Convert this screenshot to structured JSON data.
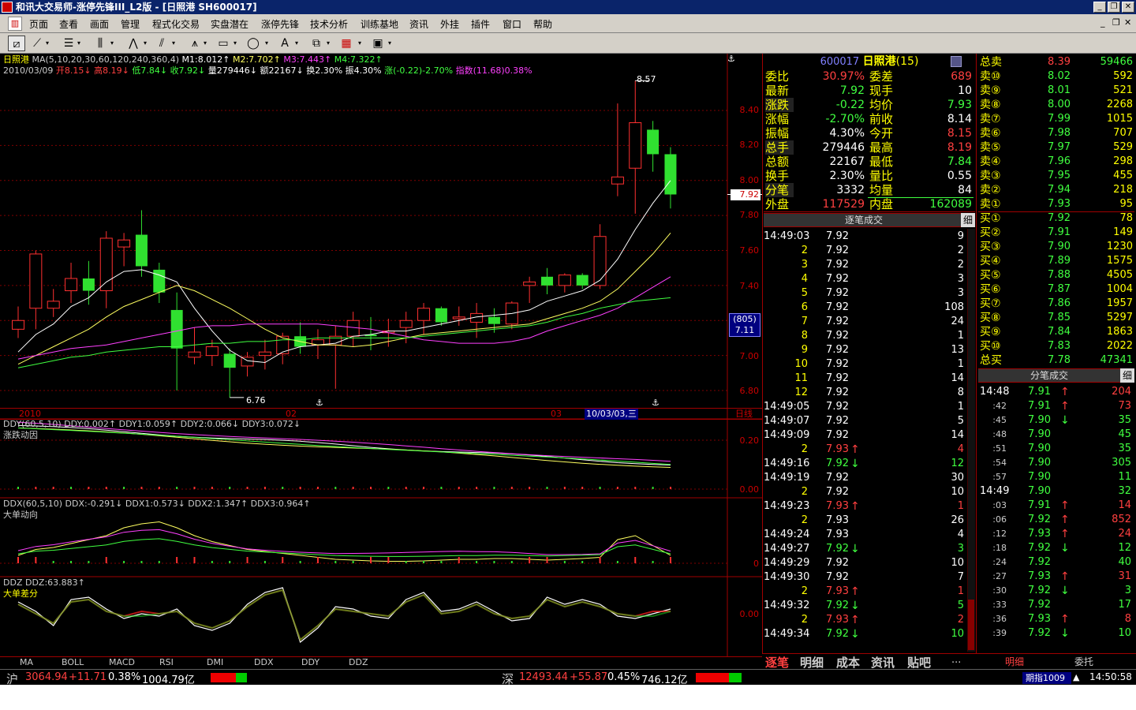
{
  "window": {
    "title": "和讯大交易师-涨停先锋III_L2版 - [日照港 SH600017]"
  },
  "menu": [
    "页面",
    "查看",
    "画面",
    "管理",
    "程式化交易",
    "实盘潜在",
    "涨停先锋",
    "技术分析",
    "训练基地",
    "资讯",
    "外挂",
    "插件",
    "窗口",
    "帮助"
  ],
  "chart": {
    "legend": {
      "stock": "日照港",
      "ma_label": "MA(5,10,20,30,60,120,240,360,4)",
      "m1": "M1:8.012↑",
      "m2": "M2:7.702↑",
      "m3": "M3:7.443↑",
      "m4": "M4:7.322↑"
    },
    "dayinfo": {
      "date": "2010/03/09",
      "open": "开8.15↓",
      "high": "高8.19↓",
      "low": "低7.84↓",
      "close": "收7.92↓",
      "vol": "量279446↓",
      "amt": "额22167↓",
      "turnover": "换2.30%",
      "amp": "振4.30%",
      "chg": "涨(-0.22)-2.70%",
      "index": "指数(11.68)0.38%"
    },
    "high_label": "8.57",
    "low_label": "6.76",
    "current_price": "7.92",
    "cursor_box": "(805)",
    "cursor_price": "7.11",
    "x_labels": {
      "y2010": "2010",
      "m02": "02",
      "m03": "03",
      "sel_date": "10/03/03,三"
    },
    "period": "日线"
  },
  "chart_data": {
    "type": "candlestick",
    "ylim": [
      6.72,
      8.64
    ],
    "yticks": [
      6.8,
      7.0,
      7.2,
      7.4,
      7.6,
      7.8,
      8.0,
      8.2,
      8.4
    ],
    "candles": [
      {
        "o": 7.15,
        "h": 7.28,
        "l": 7.1,
        "c": 7.2
      },
      {
        "o": 7.27,
        "h": 7.6,
        "l": 7.15,
        "c": 7.58
      },
      {
        "o": 7.27,
        "h": 7.38,
        "l": 7.22,
        "c": 7.31
      },
      {
        "o": 7.37,
        "h": 7.53,
        "l": 7.3,
        "c": 7.44
      },
      {
        "o": 7.44,
        "h": 7.54,
        "l": 7.29,
        "c": 7.37
      },
      {
        "o": 7.37,
        "h": 7.71,
        "l": 7.27,
        "c": 7.67
      },
      {
        "o": 7.62,
        "h": 7.7,
        "l": 7.51,
        "c": 7.66
      },
      {
        "o": 7.69,
        "h": 7.83,
        "l": 7.45,
        "c": 7.51
      },
      {
        "o": 7.49,
        "h": 7.53,
        "l": 7.3,
        "c": 7.36
      },
      {
        "o": 7.26,
        "h": 7.36,
        "l": 6.8,
        "c": 7.04
      },
      {
        "o": 6.99,
        "h": 7.16,
        "l": 6.95,
        "c": 7.02
      },
      {
        "o": 7.0,
        "h": 7.09,
        "l": 6.94,
        "c": 7.05
      },
      {
        "o": 7.01,
        "h": 7.04,
        "l": 6.76,
        "c": 6.93
      },
      {
        "o": 6.94,
        "h": 7.02,
        "l": 6.88,
        "c": 6.99
      },
      {
        "o": 7.0,
        "h": 7.09,
        "l": 6.92,
        "c": 7.02
      },
      {
        "o": 7.01,
        "h": 7.13,
        "l": 6.95,
        "c": 7.11
      },
      {
        "o": 7.11,
        "h": 7.19,
        "l": 7.01,
        "c": 7.05
      },
      {
        "o": 7.06,
        "h": 7.15,
        "l": 6.98,
        "c": 7.09
      },
      {
        "o": 7.06,
        "h": 7.17,
        "l": 6.81,
        "c": 7.11
      },
      {
        "o": 7.11,
        "h": 7.25,
        "l": 7.05,
        "c": 7.2
      },
      {
        "o": 7.12,
        "h": 7.22,
        "l": 7.03,
        "c": 7.11
      },
      {
        "o": 7.13,
        "h": 7.21,
        "l": 7.05,
        "c": 7.14
      },
      {
        "o": 7.16,
        "h": 7.25,
        "l": 7.07,
        "c": 7.2
      },
      {
        "o": 7.2,
        "h": 7.3,
        "l": 7.12,
        "c": 7.27
      },
      {
        "o": 7.27,
        "h": 7.28,
        "l": 7.17,
        "c": 7.19
      },
      {
        "o": 7.21,
        "h": 7.28,
        "l": 7.17,
        "c": 7.22
      },
      {
        "o": 7.19,
        "h": 7.3,
        "l": 7.1,
        "c": 7.24
      },
      {
        "o": 7.22,
        "h": 7.27,
        "l": 7.13,
        "c": 7.18
      },
      {
        "o": 7.18,
        "h": 7.31,
        "l": 7.15,
        "c": 7.3
      },
      {
        "o": 7.4,
        "h": 7.45,
        "l": 7.3,
        "c": 7.42
      },
      {
        "o": 7.45,
        "h": 7.5,
        "l": 7.35,
        "c": 7.4
      },
      {
        "o": 7.4,
        "h": 7.47,
        "l": 7.36,
        "c": 7.46
      },
      {
        "o": 7.46,
        "h": 7.47,
        "l": 7.38,
        "c": 7.4
      },
      {
        "o": 7.4,
        "h": 7.75,
        "l": 7.38,
        "c": 7.68
      },
      {
        "o": 7.98,
        "h": 8.44,
        "l": 7.91,
        "c": 8.02
      },
      {
        "o": 8.07,
        "h": 8.57,
        "l": 7.81,
        "c": 8.33
      },
      {
        "o": 8.29,
        "h": 8.34,
        "l": 8.05,
        "c": 8.15
      },
      {
        "o": 8.15,
        "h": 8.19,
        "l": 7.84,
        "c": 7.92
      }
    ],
    "ma": [
      {
        "color": "#ffffff",
        "values": [
          7.02,
          7.12,
          7.18,
          7.28,
          7.33,
          7.42,
          7.48,
          7.49,
          7.46,
          7.42,
          7.27,
          7.14,
          7.03,
          6.97,
          6.96,
          7.02,
          7.05,
          7.06,
          7.07,
          7.11,
          7.12,
          7.14,
          7.14,
          7.16,
          7.18,
          7.2,
          7.22,
          7.23,
          7.24,
          7.26,
          7.31,
          7.34,
          7.37,
          7.43,
          7.55,
          7.72,
          7.87,
          8.0
        ]
      },
      {
        "color": "#ffff60",
        "values": [
          6.95,
          7.0,
          7.05,
          7.1,
          7.15,
          7.22,
          7.28,
          7.32,
          7.36,
          7.4,
          7.37,
          7.32,
          7.27,
          7.21,
          7.15,
          7.1,
          7.08,
          7.06,
          7.06,
          7.05,
          7.06,
          7.08,
          7.1,
          7.12,
          7.13,
          7.14,
          7.15,
          7.16,
          7.17,
          7.18,
          7.21,
          7.24,
          7.27,
          7.31,
          7.38,
          7.48,
          7.58,
          7.7
        ]
      },
      {
        "color": "#ff40ff",
        "values": [
          6.98,
          7.0,
          7.02,
          7.04,
          7.05,
          7.06,
          7.08,
          7.1,
          7.12,
          7.14,
          7.16,
          7.17,
          7.17,
          7.18,
          7.18,
          7.18,
          7.18,
          7.18,
          7.17,
          7.16,
          7.15,
          7.13,
          7.11,
          7.09,
          7.08,
          7.07,
          7.07,
          7.07,
          7.08,
          7.1,
          7.14,
          7.17,
          7.2,
          7.23,
          7.27,
          7.33,
          7.39,
          7.45
        ]
      },
      {
        "color": "#40ff40",
        "values": [
          6.93,
          6.95,
          6.97,
          6.99,
          7.0,
          7.02,
          7.03,
          7.04,
          7.05,
          7.05,
          7.06,
          7.07,
          7.07,
          7.08,
          7.08,
          7.09,
          7.09,
          7.1,
          7.1,
          7.1,
          7.1,
          7.1,
          7.1,
          7.11,
          7.12,
          7.13,
          7.14,
          7.15,
          7.16,
          7.17,
          7.19,
          7.22,
          7.24,
          7.27,
          7.29,
          7.31,
          7.32,
          7.33
        ]
      }
    ]
  },
  "ind1": {
    "legend": "DDY(60,5,10) DDY:0.002↑ DDY1:0.059↑ DDY2:0.066↓ DDY3:0.072↓",
    "name": "涨跌动因",
    "ticks": [
      "0.20",
      "0.00"
    ]
  },
  "ind2": {
    "legend": "DDX(60,5,10) DDX:-0.291↓ DDX1:0.573↓ DDX2:1.347↑ DDX3:0.964↑",
    "name": "大单动向",
    "ticks": [
      "0"
    ]
  },
  "ind3": {
    "legend": "DDZ DDZ:63.883↑",
    "name": "大单差分",
    "ticks": [
      "0.00"
    ]
  },
  "tabs": [
    "MA",
    "BOLL",
    "MACD",
    "RSI",
    "DMI",
    "DDX",
    "DDY",
    "DDZ"
  ],
  "quote": {
    "code": "600017",
    "name": "日照港",
    "count": "(15)",
    "rows": [
      {
        "l1": "委比",
        "v1": "30.97%",
        "l2": "委差",
        "v2": "689"
      },
      {
        "l1": "最新",
        "v1": "7.92",
        "l2": "现手",
        "v2": "10"
      },
      {
        "l1": "涨跌",
        "v1": "-0.22",
        "l2": "均价",
        "v2": "7.93"
      },
      {
        "l1": "涨幅",
        "v1": "-2.70%",
        "l2": "前收",
        "v2": "8.14"
      },
      {
        "l1": "振幅",
        "v1": "4.30%",
        "l2": "今开",
        "v2": "8.15"
      },
      {
        "l1": "总手",
        "v1": "279446",
        "l2": "最高",
        "v2": "8.19"
      },
      {
        "l1": "总额",
        "v1": "22167",
        "l2": "最低",
        "v2": "7.84"
      },
      {
        "l1": "换手",
        "v1": "2.30%",
        "l2": "量比",
        "v2": "0.55"
      },
      {
        "l1": "分笔",
        "v1": "3332",
        "l2": "均量",
        "v2": "84"
      },
      {
        "l1": "外盘",
        "v1": "117529",
        "l2": "内盘",
        "v2": "162089"
      }
    ]
  },
  "ticks_title": "逐笔成交",
  "detail_btn": "细",
  "ticks": [
    {
      "t": "14:49:03",
      "p": "7.92",
      "v": "9",
      "c": "w"
    },
    {
      "t": "2",
      "p": "7.92",
      "v": "2",
      "c": "w"
    },
    {
      "t": "3",
      "p": "7.92",
      "v": "2",
      "c": "w"
    },
    {
      "t": "4",
      "p": "7.92",
      "v": "3",
      "c": "w"
    },
    {
      "t": "5",
      "p": "7.92",
      "v": "3",
      "c": "w"
    },
    {
      "t": "6",
      "p": "7.92",
      "v": "108",
      "c": "w"
    },
    {
      "t": "7",
      "p": "7.92",
      "v": "24",
      "c": "w"
    },
    {
      "t": "8",
      "p": "7.92",
      "v": "1",
      "c": "w"
    },
    {
      "t": "9",
      "p": "7.92",
      "v": "13",
      "c": "w"
    },
    {
      "t": "10",
      "p": "7.92",
      "v": "1",
      "c": "w"
    },
    {
      "t": "11",
      "p": "7.92",
      "v": "14",
      "c": "w"
    },
    {
      "t": "12",
      "p": "7.92",
      "v": "8",
      "c": "w"
    },
    {
      "t": "14:49:05",
      "p": "7.92",
      "v": "1",
      "c": "w"
    },
    {
      "t": "14:49:07",
      "p": "7.92",
      "v": "5",
      "c": "w"
    },
    {
      "t": "14:49:09",
      "p": "7.92",
      "v": "14",
      "c": "w"
    },
    {
      "t": "2",
      "p": "7.93",
      "v": "4",
      "c": "r"
    },
    {
      "t": "14:49:16",
      "p": "7.92",
      "v": "12",
      "c": "g"
    },
    {
      "t": "14:49:19",
      "p": "7.92",
      "v": "30",
      "c": "w"
    },
    {
      "t": "2",
      "p": "7.92",
      "v": "10",
      "c": "w"
    },
    {
      "t": "14:49:23",
      "p": "7.93",
      "v": "1",
      "c": "r"
    },
    {
      "t": "2",
      "p": "7.93",
      "v": "26",
      "c": "w"
    },
    {
      "t": "14:49:24",
      "p": "7.93",
      "v": "4",
      "c": "w"
    },
    {
      "t": "14:49:27",
      "p": "7.92",
      "v": "3",
      "c": "g"
    },
    {
      "t": "14:49:29",
      "p": "7.92",
      "v": "10",
      "c": "w"
    },
    {
      "t": "14:49:30",
      "p": "7.92",
      "v": "7",
      "c": "w"
    },
    {
      "t": "2",
      "p": "7.93",
      "v": "1",
      "c": "r"
    },
    {
      "t": "14:49:32",
      "p": "7.92",
      "v": "5",
      "c": "g"
    },
    {
      "t": "2",
      "p": "7.93",
      "v": "2",
      "c": "r"
    },
    {
      "t": "14:49:34",
      "p": "7.92",
      "v": "10",
      "c": "g"
    }
  ],
  "orderbook": {
    "total_sell": {
      "l": "总卖",
      "p": "8.39",
      "v": "59466"
    },
    "sells": [
      {
        "l": "卖⑩",
        "p": "8.02",
        "v": "592"
      },
      {
        "l": "卖⑨",
        "p": "8.01",
        "v": "521"
      },
      {
        "l": "卖⑧",
        "p": "8.00",
        "v": "2268"
      },
      {
        "l": "卖⑦",
        "p": "7.99",
        "v": "1015"
      },
      {
        "l": "卖⑥",
        "p": "7.98",
        "v": "707"
      },
      {
        "l": "卖⑤",
        "p": "7.97",
        "v": "529"
      },
      {
        "l": "卖④",
        "p": "7.96",
        "v": "298"
      },
      {
        "l": "卖③",
        "p": "7.95",
        "v": "455"
      },
      {
        "l": "卖②",
        "p": "7.94",
        "v": "218"
      },
      {
        "l": "卖①",
        "p": "7.93",
        "v": "95"
      }
    ],
    "buys": [
      {
        "l": "买①",
        "p": "7.92",
        "v": "78"
      },
      {
        "l": "买②",
        "p": "7.91",
        "v": "149"
      },
      {
        "l": "买③",
        "p": "7.90",
        "v": "1230"
      },
      {
        "l": "买④",
        "p": "7.89",
        "v": "1575"
      },
      {
        "l": "买⑤",
        "p": "7.88",
        "v": "4505"
      },
      {
        "l": "买⑥",
        "p": "7.87",
        "v": "1004"
      },
      {
        "l": "买⑦",
        "p": "7.86",
        "v": "1957"
      },
      {
        "l": "买⑧",
        "p": "7.85",
        "v": "5297"
      },
      {
        "l": "买⑨",
        "p": "7.84",
        "v": "1863"
      },
      {
        "l": "买⑩",
        "p": "7.83",
        "v": "2022"
      }
    ],
    "total_buy": {
      "l": "总买",
      "p": "7.78",
      "v": "47341"
    }
  },
  "fen_title": "分笔成交",
  "fen": [
    {
      "t": "14:48",
      "p": "7.91",
      "v": "204",
      "c": "r",
      "m": true
    },
    {
      "t": ":42",
      "p": "7.91",
      "v": "73",
      "c": "r"
    },
    {
      "t": ":45",
      "p": "7.90",
      "v": "35",
      "c": "g"
    },
    {
      "t": ":48",
      "p": "7.90",
      "v": "45",
      "c": "n"
    },
    {
      "t": ":51",
      "p": "7.90",
      "v": "35",
      "c": "n"
    },
    {
      "t": ":54",
      "p": "7.90",
      "v": "305",
      "c": "n"
    },
    {
      "t": ":57",
      "p": "7.90",
      "v": "11",
      "c": "n"
    },
    {
      "t": "14:49",
      "p": "7.90",
      "v": "32",
      "c": "n",
      "m": true
    },
    {
      "t": ":03",
      "p": "7.91",
      "v": "14",
      "c": "r"
    },
    {
      "t": ":06",
      "p": "7.92",
      "v": "852",
      "c": "r"
    },
    {
      "t": ":12",
      "p": "7.93",
      "v": "24",
      "c": "r"
    },
    {
      "t": ":18",
      "p": "7.92",
      "v": "12",
      "c": "g"
    },
    {
      "t": ":24",
      "p": "7.92",
      "v": "40",
      "c": "n"
    },
    {
      "t": ":27",
      "p": "7.93",
      "v": "31",
      "c": "r"
    },
    {
      "t": ":30",
      "p": "7.92",
      "v": "3",
      "c": "g"
    },
    {
      "t": ":33",
      "p": "7.92",
      "v": "17",
      "c": "n"
    },
    {
      "t": ":36",
      "p": "7.93",
      "v": "8",
      "c": "r"
    },
    {
      "t": ":39",
      "p": "7.92",
      "v": "10",
      "c": "g"
    }
  ],
  "bottom_tabs": [
    "逐笔",
    "明细",
    "成本",
    "资讯",
    "贴吧",
    "..."
  ],
  "bottom_tabs2": [
    "明细",
    "委托"
  ],
  "status": {
    "sh_label": "沪",
    "sh_value": "3064.94",
    "sh_chg": "+11.71",
    "sh_pct": "0.38%",
    "sh_amt": "1004.79亿",
    "sz_label": "深",
    "sz_value": "12493.44",
    "sz_chg": "+55.87",
    "sz_pct": "0.45%",
    "sz_amt": "746.12亿",
    "futures": "期指1009",
    "time": "14:50:58"
  }
}
